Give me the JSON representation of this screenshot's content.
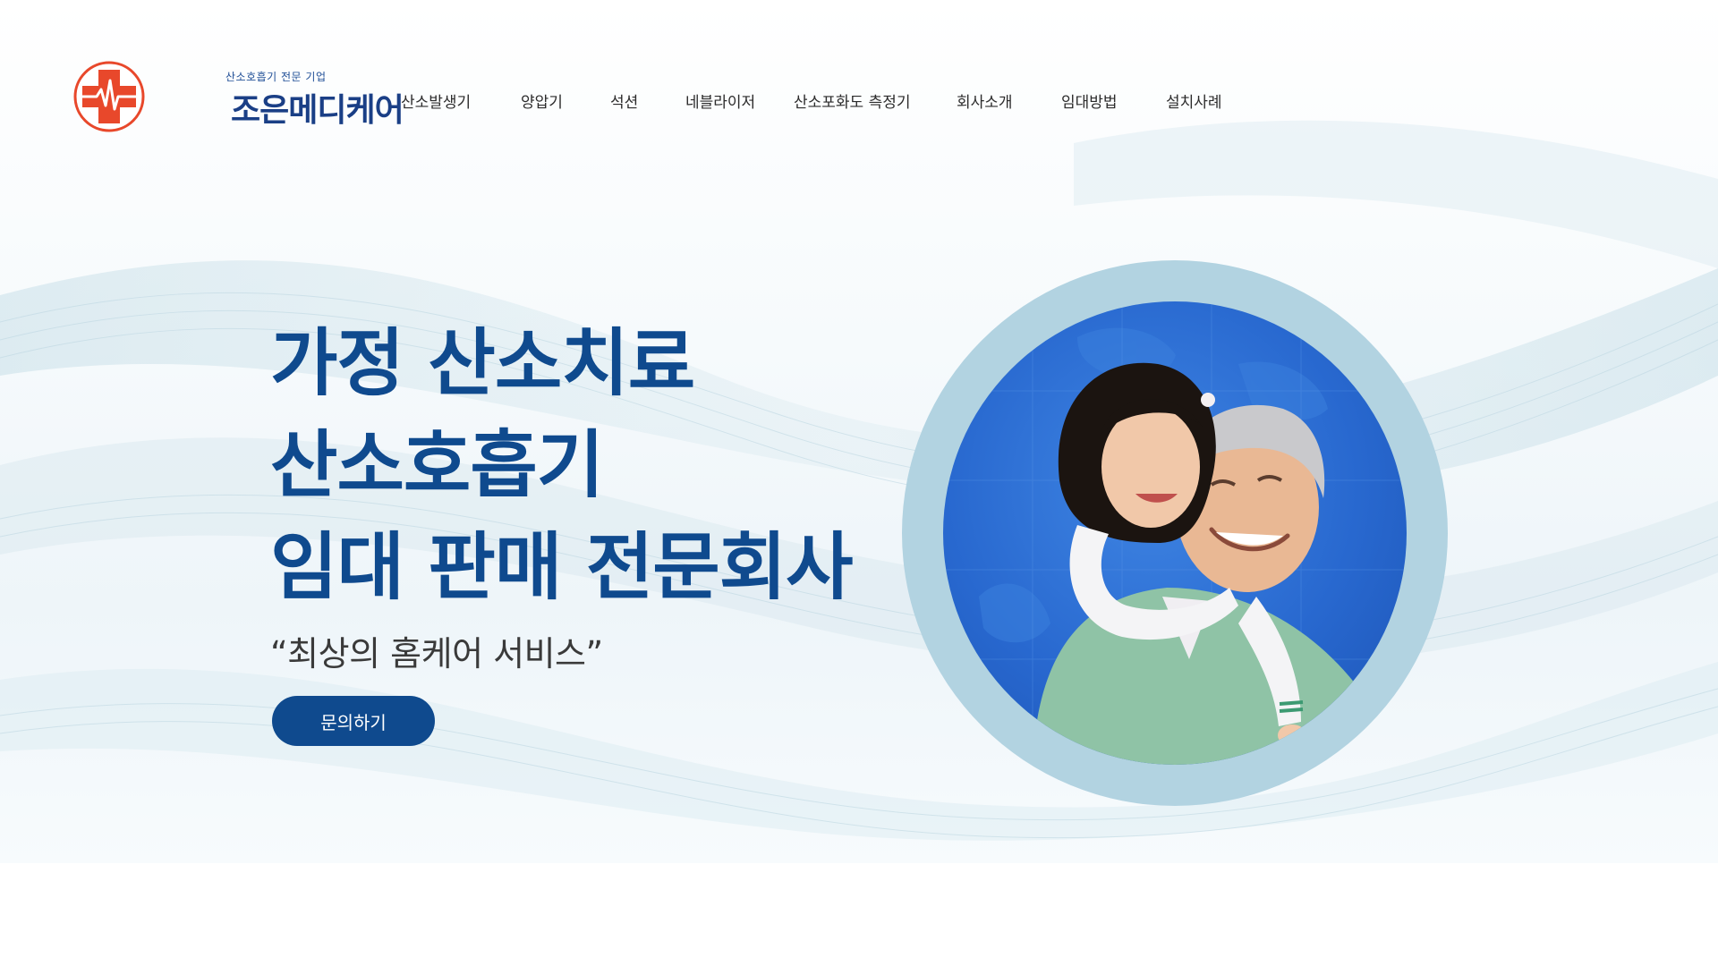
{
  "header": {
    "logo": {
      "tagline": "산소호흡기 전문 기업",
      "name": "조은메디케어"
    },
    "nav": [
      {
        "label": "산소발생기"
      },
      {
        "label": "양압기"
      },
      {
        "label": "석션"
      },
      {
        "label": "네블라이저"
      },
      {
        "label": "산소포화도 측정기"
      },
      {
        "label": "회사소개"
      },
      {
        "label": "임대방법"
      },
      {
        "label": "설치사례"
      }
    ]
  },
  "hero": {
    "headline": [
      "가정 산소치료",
      "산소호흡기",
      "임대 판매 전문회사"
    ],
    "subtitle": "“최상의 홈케어 서비스”",
    "cta_label": "문의하기",
    "image": "grandfather-and-granddaughter-photo"
  },
  "colors": {
    "brand_blue": "#0f4a8e",
    "logo_red": "#e8482b",
    "ring": "#b2d3e1",
    "circle_blue": "#2868cf"
  },
  "icons": {
    "logo_mark": "red-cross-heartbeat-icon"
  }
}
